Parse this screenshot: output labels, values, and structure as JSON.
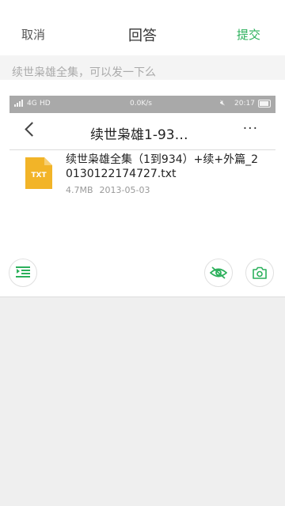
{
  "header": {
    "cancel_label": "取消",
    "title": "回答",
    "submit_label": "提交"
  },
  "question": {
    "text": "续世枭雄全集，可以发一下么"
  },
  "attachment": {
    "status_bar": {
      "network": "4G",
      "hd": "HD",
      "speed": "0.0K/s",
      "time": "20:17"
    },
    "nav": {
      "title": "续世枭雄1-93…",
      "more": "···"
    },
    "file": {
      "icon_label": "TXT",
      "name": "续世枭雄全集（1到934）+续+外篇_20130122174727.txt",
      "size": "4.7MB",
      "date": "2013-05-03"
    }
  },
  "colors": {
    "accent": "#2bb05b",
    "file_icon": "#f2b428"
  },
  "icons": {
    "format_list": "list-indent-icon",
    "privacy": "eye-off-icon",
    "camera": "camera-icon"
  }
}
